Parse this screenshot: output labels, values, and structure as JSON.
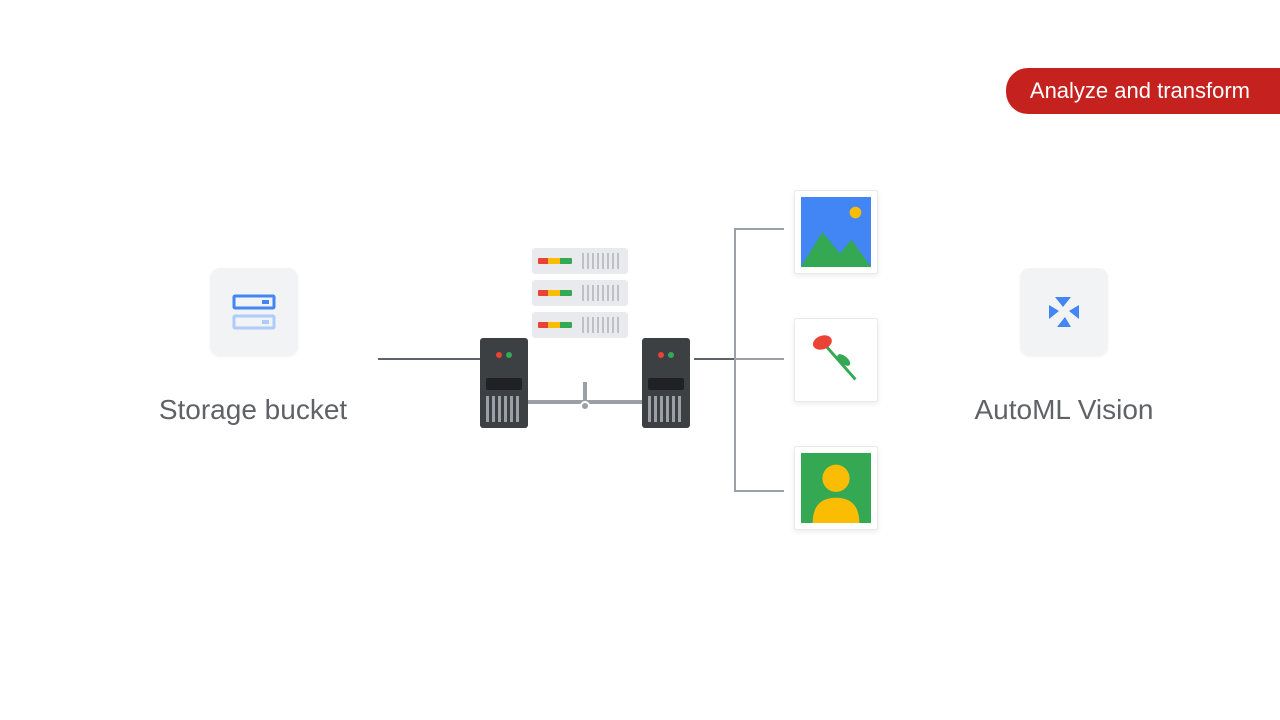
{
  "badge": {
    "label": "Analyze and transform"
  },
  "nodes": {
    "storage": {
      "label": "Storage bucket",
      "icon": "storage-bucket-icon"
    },
    "automl": {
      "label": "AutoML Vision",
      "icon": "automl-vision-icon"
    }
  },
  "cluster": {
    "name": "compute-server-cluster"
  },
  "samples": [
    {
      "name": "landscape-photo-icon"
    },
    {
      "name": "flower-photo-icon"
    },
    {
      "name": "person-avatar-icon"
    }
  ],
  "colors": {
    "badge_bg": "#c5221f",
    "text": "#5f6368",
    "accent_blue": "#4285f4",
    "green": "#34a853",
    "yellow": "#fbbc04",
    "red": "#ea4335"
  }
}
